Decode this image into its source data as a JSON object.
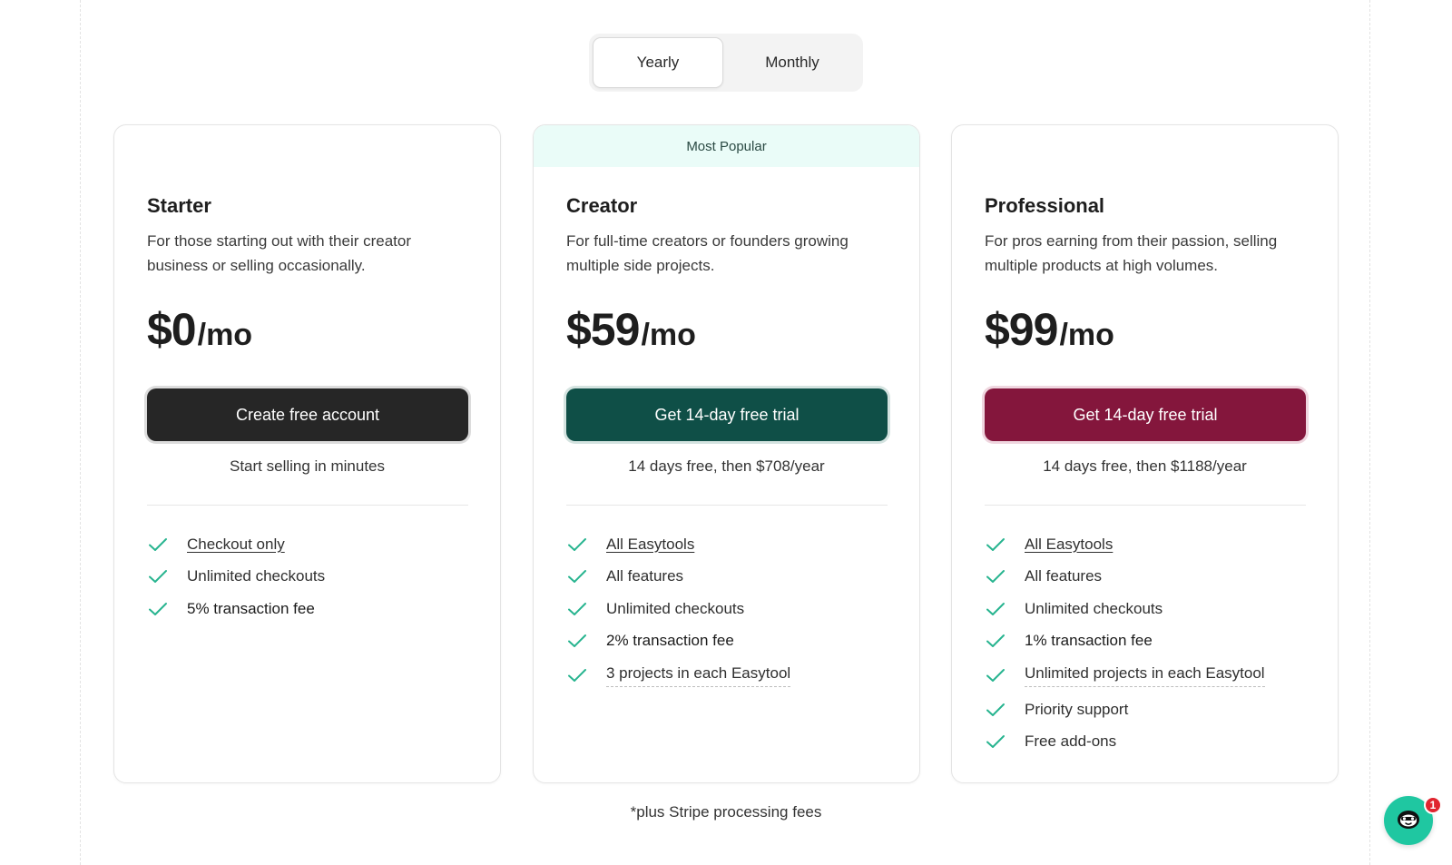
{
  "billing_toggle": {
    "options": [
      "Yearly",
      "Monthly"
    ],
    "selected": "Yearly"
  },
  "plans": [
    {
      "name": "Starter",
      "description": "For those starting out with their creator business or selling occasionally.",
      "price": "$0",
      "unit": "/mo",
      "cta_label": "Create free account",
      "cta_note": "Start selling in minutes",
      "features": [
        {
          "text": "Checkout only",
          "style": "link"
        },
        {
          "text": "Unlimited checkouts",
          "style": "plain"
        },
        {
          "text": "5% transaction fee",
          "style": "strong"
        }
      ]
    },
    {
      "name": "Creator",
      "badge": "Most Popular",
      "description": "For full-time creators or founders growing multiple side projects.",
      "price": "$59",
      "unit": "/mo",
      "cta_label": "Get 14-day free trial",
      "cta_note": "14 days free, then $708/year",
      "features": [
        {
          "text": "All Easytools",
          "style": "link"
        },
        {
          "text": "All features",
          "style": "plain"
        },
        {
          "text": "Unlimited checkouts",
          "style": "plain"
        },
        {
          "text": "2% transaction fee",
          "style": "strong"
        },
        {
          "text": "3 projects in each Easytool",
          "style": "dotted"
        }
      ]
    },
    {
      "name": "Professional",
      "description": "For pros earning from their passion, selling multiple products at high volumes.",
      "price": "$99",
      "unit": "/mo",
      "cta_label": "Get 14-day free trial",
      "cta_note": "14 days free, then $1188/year",
      "features": [
        {
          "text": "All Easytools",
          "style": "link"
        },
        {
          "text": "All features",
          "style": "plain"
        },
        {
          "text": "Unlimited checkouts",
          "style": "plain"
        },
        {
          "text": "1% transaction fee",
          "style": "strong"
        },
        {
          "text": "Unlimited projects in each Easytool",
          "style": "dotted"
        },
        {
          "text": "Priority support",
          "style": "plain"
        },
        {
          "text": "Free add-ons",
          "style": "plain"
        }
      ]
    }
  ],
  "footnote": "*plus Stripe processing fees",
  "chat_widget": {
    "icon": "chat-mascot-icon",
    "badge_count": "1"
  },
  "colors": {
    "check": "#27b48f",
    "starter_cta": "#262626",
    "creator_cta": "#0f4f47",
    "professional_cta": "#84163c",
    "popular_banner": "#eafcf8",
    "chat_button": "#1fc7a1"
  }
}
